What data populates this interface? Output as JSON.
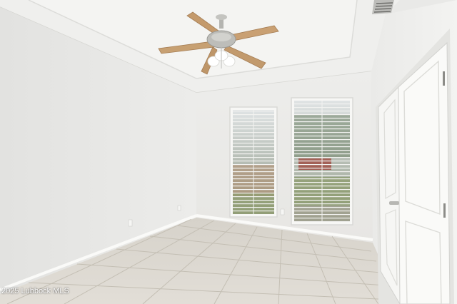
{
  "photo": {
    "subject": "empty-bedroom-interior",
    "watermark": "2025 Lubbock MLS"
  },
  "colors": {
    "wall_left": "#e6e6e4",
    "wall_back": "#ecebea",
    "ceiling": "#f1f1ef",
    "floor_tile": "#dcd8d0",
    "grout": "#c6c1b6",
    "fan_blade": "#c49a6c",
    "door": "#f7f7f5"
  },
  "icons": {
    "ceiling_fan": "ceiling-fan-icon",
    "vent": "air-vent-icon"
  }
}
